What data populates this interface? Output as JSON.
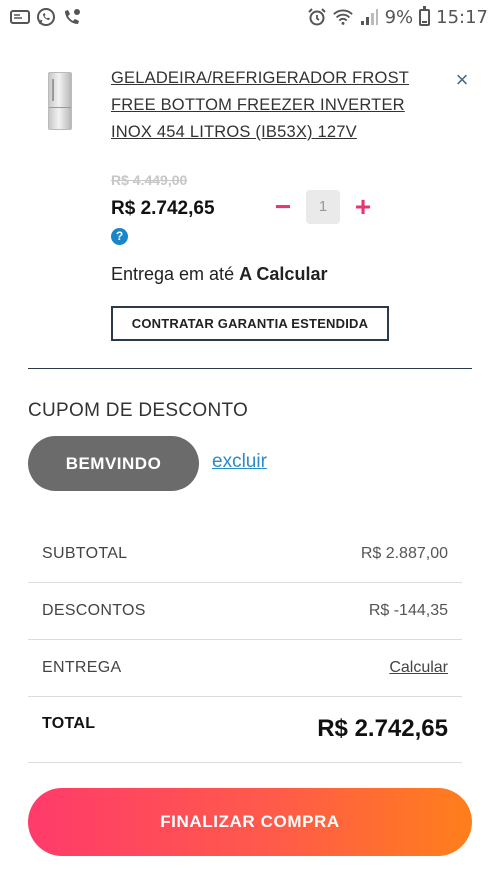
{
  "status_bar": {
    "battery_percent": "9%",
    "time": "15:17",
    "left_icons": [
      "notification-icon",
      "whatsapp-icon",
      "phone-missed-icon"
    ],
    "right_icons": [
      "alarm-icon",
      "wifi-icon",
      "signal-icon",
      "battery-icon"
    ]
  },
  "product": {
    "title": "GELADEIRA/REFRIGERADOR FROST FREE BOTTOM FREEZER INVERTER INOX 454 LITROS (IB53X) 127V",
    "old_price": "R$ 4.449,00",
    "price": "R$ 2.742,65",
    "help_symbol": "?",
    "quantity": "1",
    "qty_minus": "−",
    "qty_plus": "+",
    "delivery_prefix": "Entrega em até",
    "delivery_value": "A Calcular",
    "warranty_button": "CONTRATAR GARANTIA ESTENDIDA",
    "remove_symbol": "×"
  },
  "coupon": {
    "label": "CUPOM DE DESCONTO",
    "code": "BEMVINDO",
    "remove_link": "excluir"
  },
  "summary": {
    "rows": [
      {
        "label": "SUBTOTAL",
        "value": "R$ 2.887,00"
      },
      {
        "label": "DESCONTOS",
        "value": "R$ -144,35"
      },
      {
        "label": "ENTREGA",
        "value": "Calcular"
      }
    ],
    "total_label": "TOTAL",
    "total_value": "R$ 2.742,65"
  },
  "checkout_button": "FINALIZAR COMPRA",
  "colors": {
    "accent_pink": "#e8356d",
    "link_blue": "#2a8bc6",
    "button_gradient_start": "#ff3b6b",
    "button_gradient_end": "#ff7f1a",
    "coupon_pill": "#6b6b6b"
  }
}
